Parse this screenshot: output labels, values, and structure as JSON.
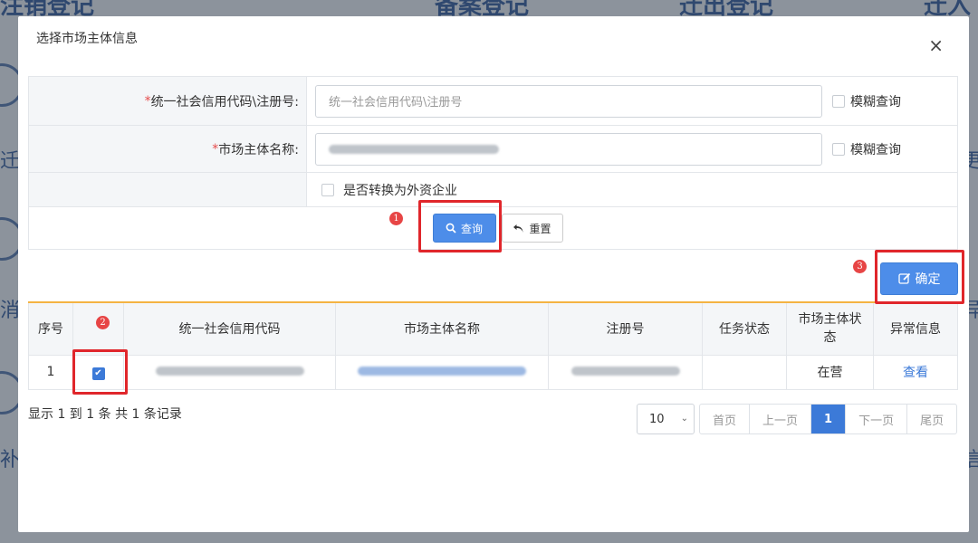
{
  "background": {
    "titles": [
      "注销登记",
      "备案登记",
      "迁出登记",
      "迁入登"
    ],
    "side_left": [
      "迁",
      "消",
      "补"
    ],
    "side_right": [
      "更",
      "异",
      "信"
    ]
  },
  "modal": {
    "title": "选择市场主体信息",
    "close_glyph": "×"
  },
  "form": {
    "credit_code": {
      "required_mark": "*",
      "label": "统一社会信用代码\\注册号:",
      "placeholder": "统一社会信用代码\\注册号",
      "fuzzy_label": "模糊查询"
    },
    "entity_name": {
      "required_mark": "*",
      "label": "市场主体名称:",
      "fuzzy_label": "模糊查询"
    },
    "foreign_label": "是否转换为外资企业",
    "search_button": "查询",
    "reset_button": "重置"
  },
  "confirm_button": "确定",
  "table": {
    "headers": [
      "序号",
      "",
      "统一社会信用代码",
      "市场主体名称",
      "注册号",
      "任务状态",
      "市场主体状态",
      "异常信息"
    ],
    "row": {
      "index": "1",
      "task_status": "",
      "entity_status": "在营",
      "exception_link": "查看"
    }
  },
  "summary": "显示 1 到 1 条 共 1 条记录",
  "pagination": {
    "page_size": "10",
    "first": "首页",
    "prev": "上一页",
    "current": "1",
    "next": "下一页",
    "last": "尾页"
  },
  "annotations": [
    "1",
    "2",
    "3"
  ],
  "colors": {
    "primary": "#4d8de9",
    "highlight": "#e0262b",
    "table_accent": "#f4b342",
    "link": "#3c7ad8"
  }
}
